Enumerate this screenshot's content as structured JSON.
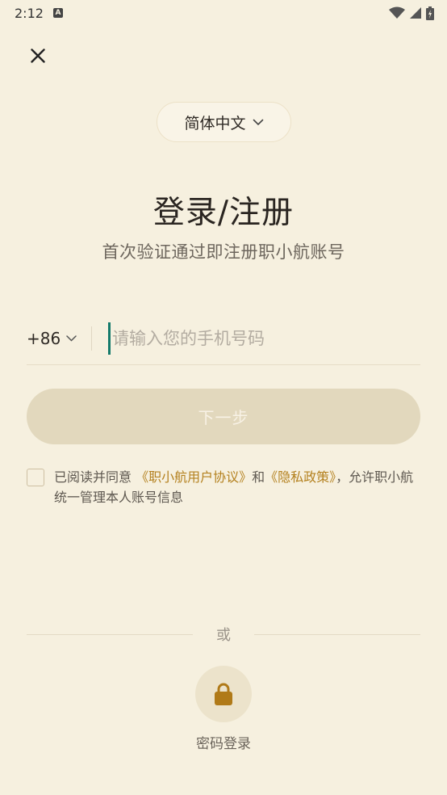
{
  "status_bar": {
    "time": "2:12",
    "notification_icon": "a-icon",
    "icons": [
      "wifi-icon",
      "signal-icon",
      "battery-icon"
    ]
  },
  "header": {
    "close_icon": "close-icon"
  },
  "language": {
    "label": "简体中文",
    "icon": "chevron-down-icon"
  },
  "title": "登录/注册",
  "subtitle": "首次验证通过即注册职小航账号",
  "phone": {
    "country_code": "+86",
    "placeholder": "请输入您的手机号码",
    "value": ""
  },
  "next_button": {
    "label": "下一步",
    "enabled": false
  },
  "agreement": {
    "checked": false,
    "prefix": "已阅读并同意 ",
    "user_agreement": "《职小航用户协议》",
    "connector": "和",
    "privacy_policy": "《隐私政策》",
    "suffix": "，允许职小航统一管理本人账号信息"
  },
  "divider_text": "或",
  "password_login": {
    "icon": "lock-icon",
    "label": "密码登录"
  },
  "colors": {
    "background": "#f6f0df",
    "accent_link": "#b4811f",
    "button_disabled": "#e2d8bd",
    "lock_icon": "#b07a18",
    "cursor": "#147a6b"
  }
}
